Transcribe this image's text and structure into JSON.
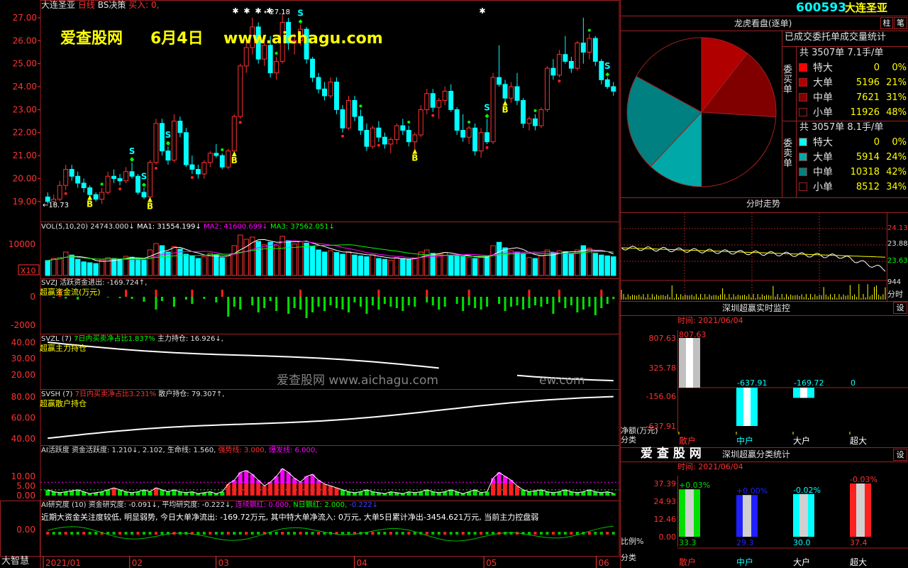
{
  "app": {
    "stock_name": "大连圣亚",
    "stock_code": "600593",
    "period": "日线",
    "indicator_name": "BS决策",
    "indicator_param": "买入: 0,",
    "brand": "大智慧"
  },
  "watermark": {
    "site_cn": "爱查股网",
    "date": "6月4日",
    "url": "www.aichagu.com",
    "faded": "爱查股网     www.aichagu.com",
    "faded_tail": "ew.com",
    "logo": "爱 查 股 网"
  },
  "colors": {
    "up": "#ff3232",
    "down": "#00ffff",
    "ma1": "#ffffff",
    "ma2": "#ff00ff",
    "ma3": "#00ff00",
    "border": "#a02020",
    "yellow": "#ffff00"
  },
  "price_panel": {
    "y_ticks": [
      "27.00",
      "26.00",
      "25.00",
      "24.00",
      "23.00",
      "22.00",
      "21.00",
      "20.00",
      "19.00"
    ],
    "high_label": "27.18",
    "low_label": "18.73",
    "x_ticks": [
      "2021/01",
      "02",
      "03",
      "04",
      "05",
      "06"
    ]
  },
  "vol_panel": {
    "title": "VOL(5,10,20)",
    "vol": "24743.000↓",
    "ma1": "MA1: 31554.199↓",
    "ma2": "MA2: 41600.699↓",
    "ma3": "MA3: 37562.051↓",
    "y_tick": "10000",
    "unit": "X10"
  },
  "svzj_panel": {
    "title": "SVZJ",
    "label": "活跃资金进出: -169.724↑,",
    "sub": "超赢资金流(万元)",
    "y_ticks": [
      "0",
      "-2000"
    ]
  },
  "svzl_panel": {
    "title": "SVZL (7)",
    "stat": "7日内买卖净占比1.837%",
    "label": "主力持仓: 16.926↓,",
    "sub": "超赢主力持仓",
    "y_ticks": [
      "40.00",
      "30.00",
      "20.00"
    ]
  },
  "svsh_panel": {
    "title": "SVSH (7)",
    "stat": "7日内买卖净占比3.231%",
    "label": "散户持仓: 79.307↑,",
    "sub": "超赢散户持仓",
    "y_ticks": [
      "80.00",
      "60.00",
      "40.00"
    ]
  },
  "ai_active_panel": {
    "title": "AI活跃度",
    "a": "资金活跃度: 1.210↓,",
    "b": "2.102,",
    "c": "生命线: 1.560,",
    "d": "强势线: 3.000,",
    "e": "爆发线: 6.000,",
    "y_ticks": [
      "10.00",
      "5.00",
      "0.00"
    ]
  },
  "ai_research_panel": {
    "title": "AI研究度 (10)",
    "a": "资金研究度: -0.091↓,",
    "b": "平均研究度: -0.222↓,",
    "c": "连续飘红: 0.000,",
    "d": "N日飘红: 2.000,",
    "e": "-0.222↓",
    "comment": "近期大资金关注度较低, 明显弱势, 今日大单净流出: -169.72万元, 其中特大单净流入: 0万元, 大单5日累计净出-3454.621万元, 当前主力控盘弱",
    "y_tick": "0.00"
  },
  "dragon_panel": {
    "title": "龙虎看盘(逐单)",
    "header": "已成交委托单成交量统计",
    "buy_side": "委买单",
    "sell_side": "委卖单",
    "buy_total": "共 3507单 7.1手/单",
    "sell_total": "共 3057单 8.1手/单",
    "buy_rows": [
      {
        "name": "特大",
        "vol": "0",
        "pct": "0%",
        "color": "#ff0000"
      },
      {
        "name": "大单",
        "vol": "5196",
        "pct": "21%",
        "color": "#b00000"
      },
      {
        "name": "中单",
        "vol": "7621",
        "pct": "31%",
        "color": "#800000"
      },
      {
        "name": "小单",
        "vol": "11926",
        "pct": "48%",
        "color": "#000000"
      }
    ],
    "sell_rows": [
      {
        "name": "特大",
        "vol": "0",
        "pct": "0%",
        "color": "#00ffff"
      },
      {
        "name": "大单",
        "vol": "5914",
        "pct": "24%",
        "color": "#00a8a8"
      },
      {
        "name": "中单",
        "vol": "10318",
        "pct": "42%",
        "color": "#008080"
      },
      {
        "name": "小单",
        "vol": "8512",
        "pct": "34%",
        "color": "#000000"
      }
    ],
    "tab1": "柱",
    "tab2": "笔"
  },
  "intraday_panel": {
    "title": "分时走势",
    "y_ticks": [
      "24.13",
      "23.88",
      "23.63"
    ],
    "vol_tick": "944",
    "vol_label": "分时"
  },
  "monitor_panel": {
    "title": "深圳超赢实时监控",
    "btn": "设",
    "time": "时间: 2021/06/04",
    "y_ticks": [
      "807.63",
      "325.78",
      "-156.06",
      "-637.91"
    ],
    "unit": "净额(万元)",
    "category_label": "分类",
    "categories": [
      "散户",
      "中户",
      "大户",
      "超大"
    ]
  },
  "classify_panel": {
    "title": "深圳超赢分类统计",
    "btn": "设",
    "time": "时间: 2021/06/04",
    "y_ticks": [
      "37.39",
      "24.93",
      "12.46",
      "0.00"
    ],
    "ratio_label": "比例%",
    "category_label": "分类",
    "categories": [
      "散户",
      "中户",
      "大户",
      "超大"
    ]
  },
  "chart_data": [
    {
      "type": "candlestick",
      "series_name": "大连圣亚",
      "x_labels": [
        "2021/01",
        "02",
        "03",
        "04",
        "05",
        "06"
      ],
      "ylim": [
        18.5,
        27.4
      ],
      "ohlc": [
        [
          19.2,
          19.4,
          18.9,
          19.0
        ],
        [
          19.0,
          19.3,
          18.8,
          19.1
        ],
        [
          19.1,
          19.9,
          19.0,
          19.7
        ],
        [
          19.7,
          20.6,
          19.5,
          20.4
        ],
        [
          20.4,
          20.6,
          19.9,
          20.1
        ],
        [
          20.1,
          20.3,
          19.6,
          19.8
        ],
        [
          19.8,
          20.0,
          19.4,
          19.6
        ],
        [
          19.6,
          19.7,
          19.2,
          19.3
        ],
        [
          19.3,
          19.4,
          19.0,
          19.1
        ],
        [
          19.1,
          19.6,
          18.9,
          19.4
        ],
        [
          19.4,
          20.3,
          19.3,
          20.1
        ],
        [
          20.1,
          20.4,
          19.8,
          20.0
        ],
        [
          20.0,
          20.2,
          19.7,
          19.9
        ],
        [
          19.9,
          20.5,
          19.8,
          20.3
        ],
        [
          20.3,
          20.7,
          20.0,
          20.1
        ],
        [
          20.1,
          20.2,
          19.3,
          19.4
        ],
        [
          19.4,
          19.6,
          19.1,
          19.2
        ],
        [
          19.2,
          20.8,
          19.1,
          20.7
        ],
        [
          20.7,
          22.6,
          20.6,
          22.4
        ],
        [
          22.4,
          22.6,
          21.0,
          21.2
        ],
        [
          21.2,
          21.4,
          20.6,
          20.8
        ],
        [
          20.8,
          22.8,
          20.7,
          22.5
        ],
        [
          22.5,
          22.7,
          21.8,
          22.0
        ],
        [
          22.0,
          22.2,
          20.5,
          20.6
        ],
        [
          20.6,
          21.0,
          20.2,
          20.4
        ],
        [
          20.4,
          20.6,
          20.0,
          20.2
        ],
        [
          20.2,
          20.8,
          20.0,
          20.7
        ],
        [
          20.7,
          21.2,
          20.5,
          21.1
        ],
        [
          21.1,
          21.5,
          20.9,
          21.0
        ],
        [
          21.0,
          21.1,
          20.4,
          20.5
        ],
        [
          20.5,
          21.3,
          20.4,
          21.2
        ],
        [
          21.2,
          22.8,
          21.1,
          22.7
        ],
        [
          22.7,
          25.0,
          22.6,
          24.9
        ],
        [
          24.9,
          26.1,
          24.6,
          25.7
        ],
        [
          25.7,
          27.0,
          25.4,
          26.6
        ],
        [
          26.6,
          26.8,
          25.0,
          25.2
        ],
        [
          25.2,
          26.0,
          24.9,
          25.8
        ],
        [
          25.8,
          26.2,
          24.4,
          24.6
        ],
        [
          24.6,
          25.3,
          24.3,
          25.1
        ],
        [
          25.1,
          27.18,
          25.0,
          26.8
        ],
        [
          26.8,
          27.0,
          25.6,
          25.9
        ],
        [
          25.9,
          26.3,
          25.4,
          26.0
        ],
        [
          26.0,
          26.7,
          25.8,
          26.5
        ],
        [
          26.5,
          26.6,
          25.0,
          25.2
        ],
        [
          25.2,
          25.3,
          24.2,
          24.4
        ],
        [
          24.4,
          24.6,
          23.7,
          23.9
        ],
        [
          23.9,
          24.2,
          23.4,
          23.6
        ],
        [
          23.6,
          24.4,
          23.5,
          24.2
        ],
        [
          24.2,
          24.4,
          22.8,
          23.0
        ],
        [
          23.0,
          23.2,
          22.0,
          22.2
        ],
        [
          22.2,
          23.6,
          22.1,
          23.4
        ],
        [
          23.4,
          23.6,
          22.5,
          22.7
        ],
        [
          22.7,
          23.0,
          21.9,
          22.1
        ],
        [
          22.1,
          22.4,
          21.2,
          21.4
        ],
        [
          21.4,
          22.3,
          21.3,
          22.2
        ],
        [
          22.2,
          22.5,
          21.6,
          21.8
        ],
        [
          21.8,
          22.0,
          21.3,
          21.5
        ],
        [
          21.5,
          21.8,
          21.1,
          21.7
        ],
        [
          21.7,
          22.4,
          21.5,
          22.3
        ],
        [
          22.3,
          22.6,
          21.9,
          22.1
        ],
        [
          22.1,
          22.3,
          21.4,
          21.6
        ],
        [
          21.6,
          22.0,
          21.2,
          21.9
        ],
        [
          21.9,
          23.2,
          21.8,
          23.0
        ],
        [
          23.0,
          23.9,
          22.8,
          23.7
        ],
        [
          23.7,
          23.9,
          22.9,
          23.1
        ],
        [
          23.1,
          23.5,
          22.6,
          23.4
        ],
        [
          23.4,
          24.0,
          23.2,
          23.8
        ],
        [
          23.8,
          24.1,
          22.9,
          23.0
        ],
        [
          23.0,
          23.1,
          21.9,
          22.1
        ],
        [
          22.1,
          22.8,
          21.6,
          21.8
        ],
        [
          21.8,
          22.3,
          21.5,
          22.2
        ],
        [
          22.2,
          22.4,
          21.0,
          21.2
        ],
        [
          21.2,
          22.2,
          20.9,
          22.0
        ],
        [
          22.0,
          22.6,
          21.5,
          21.6
        ],
        [
          21.6,
          24.6,
          21.5,
          24.4
        ],
        [
          24.4,
          25.8,
          24.0,
          24.1
        ],
        [
          24.1,
          24.3,
          23.3,
          23.5
        ],
        [
          23.5,
          24.2,
          23.3,
          24.0
        ],
        [
          24.0,
          24.6,
          23.2,
          23.4
        ],
        [
          23.4,
          23.5,
          22.2,
          22.4
        ],
        [
          22.4,
          22.7,
          22.1,
          22.6
        ],
        [
          22.6,
          22.8,
          22.1,
          22.3
        ],
        [
          22.3,
          23.1,
          22.2,
          23.0
        ],
        [
          23.0,
          24.9,
          22.9,
          24.8
        ],
        [
          24.8,
          25.2,
          24.3,
          24.5
        ],
        [
          24.5,
          25.6,
          24.4,
          25.4
        ],
        [
          25.4,
          26.2,
          25.0,
          25.1
        ],
        [
          25.1,
          25.3,
          24.6,
          24.8
        ],
        [
          24.8,
          26.0,
          24.7,
          25.9
        ],
        [
          25.9,
          27.0,
          25.0,
          25.5
        ],
        [
          25.5,
          26.3,
          25.2,
          26.1
        ],
        [
          26.1,
          26.2,
          24.9,
          25.1
        ],
        [
          25.1,
          25.2,
          24.1,
          24.3
        ],
        [
          24.3,
          24.4,
          23.9,
          24.0
        ],
        [
          24.0,
          24.2,
          23.6,
          23.8
        ]
      ],
      "b_signals": [
        7,
        17,
        31,
        61,
        76
      ],
      "s_signals": [
        14,
        16,
        20,
        42,
        73,
        93
      ]
    },
    {
      "type": "bar",
      "series_name": "VOL",
      "values": [
        35,
        40,
        42,
        55,
        48,
        38,
        32,
        30,
        28,
        36,
        42,
        40,
        38,
        45,
        43,
        40,
        36,
        60,
        75,
        70,
        55,
        68,
        62,
        50,
        45,
        40,
        44,
        52,
        48,
        42,
        46,
        70,
        95,
        85,
        90,
        80,
        72,
        78,
        70,
        92,
        82,
        74,
        80,
        76,
        68,
        60,
        55,
        58,
        54,
        50,
        56,
        48,
        46,
        44,
        48,
        40,
        38,
        36,
        42,
        40,
        38,
        40,
        55,
        60,
        52,
        50,
        54,
        48,
        46,
        44,
        42,
        40,
        44,
        46,
        70,
        78,
        65,
        58,
        55,
        50,
        42,
        40,
        46,
        60,
        54,
        58,
        56,
        50,
        60,
        70,
        64,
        52,
        48,
        46,
        44
      ]
    },
    {
      "type": "bar",
      "series_name": "SVZJ",
      "values": [
        0,
        -80,
        0,
        -120,
        0,
        -200,
        0,
        -60,
        0,
        0,
        -40,
        0,
        -100,
        0,
        -150,
        0,
        -350,
        0,
        -900,
        -300,
        0,
        -700,
        0,
        -200,
        -500,
        0,
        -150,
        0,
        -400,
        0,
        -1400,
        -700,
        -900,
        0,
        -600,
        -1100,
        -800,
        -300,
        -1000,
        0,
        -1200,
        -800,
        -900,
        -1500,
        -1100,
        -700,
        -1000,
        -600,
        -800,
        -900,
        -1100,
        -400,
        -700,
        -1200,
        -600,
        -900,
        -500,
        -700,
        -800,
        -1000,
        -600,
        -700,
        0,
        -400,
        -600,
        -900,
        -700,
        0,
        -500,
        -1000,
        -600,
        -800,
        -900,
        -700,
        0,
        -500,
        -1000,
        -700,
        -600,
        -900,
        -800,
        -600,
        -700,
        -500,
        -1200,
        -400,
        -800,
        -600,
        -1100,
        -900,
        -700,
        -1300,
        -800,
        -500,
        -169.724
      ],
      "positive": [
        2,
        13,
        18,
        24,
        29,
        42,
        55,
        63,
        70,
        80,
        85,
        92
      ]
    },
    {
      "type": "line",
      "series_name": "主力持仓",
      "y_ticks": [
        40,
        30,
        20
      ],
      "start": 40.2,
      "end": 16.926
    },
    {
      "type": "line",
      "series_name": "散户持仓",
      "y_ticks": [
        80,
        60,
        40
      ],
      "start": 40.5,
      "end": 79.307
    },
    {
      "type": "bar",
      "series_name": "AI活跃度",
      "values": [
        3,
        2,
        1.5,
        2,
        2.5,
        3,
        2,
        1,
        1.5,
        2,
        3,
        4,
        3,
        2,
        1.5,
        2,
        3,
        2,
        4,
        3,
        2,
        3,
        2,
        1.5,
        2,
        1,
        1.5,
        2,
        1,
        2,
        6,
        8,
        12,
        13,
        11,
        8,
        5,
        7,
        10,
        14,
        12,
        9,
        7,
        10,
        11,
        8,
        6,
        5,
        4,
        3,
        2,
        1.5,
        2,
        3,
        2,
        1.5,
        1,
        2,
        1.5,
        1,
        2,
        1.5,
        2,
        3,
        2,
        1.5,
        2,
        3,
        2,
        1,
        2,
        3,
        1.5,
        2,
        9,
        12,
        10,
        8,
        5,
        3,
        2,
        2.5,
        3,
        2,
        1.5,
        2,
        3,
        2,
        1.5,
        2,
        3,
        2,
        1.5,
        2,
        1.21
      ],
      "life_line": 1.56,
      "strong_line": 3.0,
      "burst_line": 6.0
    },
    {
      "type": "pie",
      "series_name": "委买/委卖",
      "values": [
        21,
        31,
        48,
        24,
        42,
        34
      ],
      "labels": [
        "买大单",
        "买中单",
        "买小单",
        "卖大单",
        "卖中单",
        "卖小单"
      ]
    },
    {
      "type": "bar",
      "series_name": "深圳超赢实时监控",
      "categories": [
        "散户",
        "中户",
        "大户",
        "超大"
      ],
      "values": [
        807.63,
        -637.91,
        -169.72,
        0
      ]
    },
    {
      "type": "bar",
      "series_name": "深圳超赢分类统计",
      "categories": [
        "散户",
        "中户",
        "大户",
        "超大"
      ],
      "values": [
        33.3,
        29.3,
        30.0,
        37.4
      ],
      "changes": [
        "+0.03%",
        "+0.00%",
        "-0.02%",
        "-0.03%"
      ]
    }
  ]
}
